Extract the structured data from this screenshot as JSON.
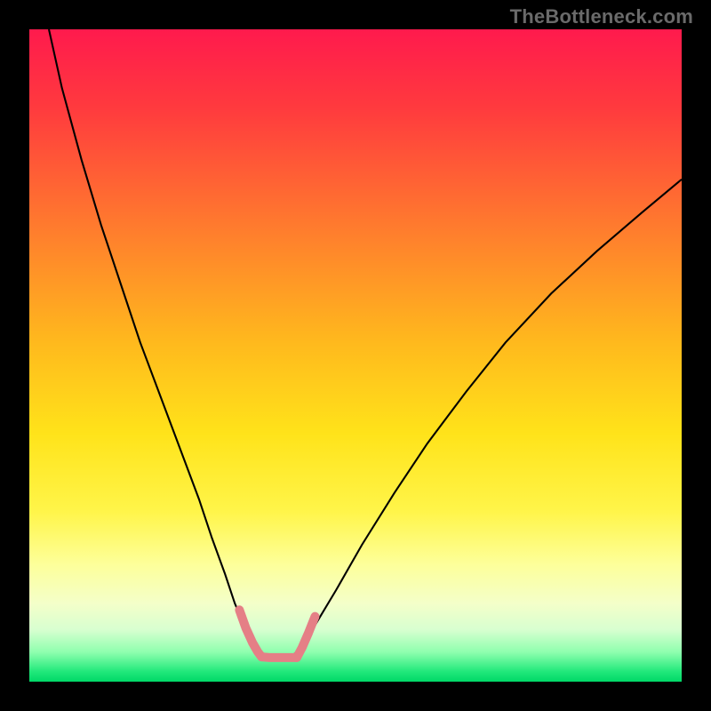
{
  "watermark": {
    "text": "TheBottleneck.com"
  },
  "chart_data": {
    "type": "line",
    "title": "",
    "xlabel": "",
    "ylabel": "",
    "xlim": [
      0,
      100
    ],
    "ylim": [
      0,
      100
    ],
    "grid": false,
    "legend": false,
    "gradient_stops": [
      {
        "pos": 0.0,
        "color": "#ff1a4d"
      },
      {
        "pos": 0.12,
        "color": "#ff3a3e"
      },
      {
        "pos": 0.3,
        "color": "#ff7a2e"
      },
      {
        "pos": 0.48,
        "color": "#ffb91d"
      },
      {
        "pos": 0.62,
        "color": "#ffe31a"
      },
      {
        "pos": 0.74,
        "color": "#fff54a"
      },
      {
        "pos": 0.82,
        "color": "#fdff9a"
      },
      {
        "pos": 0.88,
        "color": "#f4ffc9"
      },
      {
        "pos": 0.92,
        "color": "#d8ffd0"
      },
      {
        "pos": 0.955,
        "color": "#8effae"
      },
      {
        "pos": 0.985,
        "color": "#20e87a"
      },
      {
        "pos": 1.0,
        "color": "#00d867"
      }
    ],
    "series": [
      {
        "name": "left-branch",
        "stroke": "#000000",
        "stroke_width": 2.1,
        "x": [
          3,
          5,
          8,
          11,
          14,
          17,
          20,
          23,
          26,
          28,
          30,
          31.5,
          33,
          34,
          34.8,
          35.4
        ],
        "y": [
          100,
          91,
          80,
          70,
          61,
          52,
          44,
          36,
          28,
          22,
          16.5,
          12,
          8.5,
          6,
          4.4,
          3.7
        ]
      },
      {
        "name": "right-branch",
        "stroke": "#000000",
        "stroke_width": 2.1,
        "x": [
          40,
          41.5,
          44,
          47,
          51,
          56,
          61,
          67,
          73,
          80,
          87,
          94,
          100
        ],
        "y": [
          3.7,
          5,
          9,
          14,
          21,
          29,
          36.5,
          44.5,
          52,
          59.5,
          66,
          72,
          77
        ]
      },
      {
        "name": "handle-left",
        "stroke": "#e57f86",
        "stroke_width": 10,
        "linecap": "round",
        "x": [
          32.2,
          33.2,
          34.2,
          35.0,
          35.6
        ],
        "y": [
          11.0,
          8.2,
          6.0,
          4.6,
          3.8
        ]
      },
      {
        "name": "handle-bottom",
        "stroke": "#e57f86",
        "stroke_width": 10,
        "linecap": "round",
        "x": [
          35.6,
          36.8,
          38.2,
          39.6,
          41.0
        ],
        "y": [
          3.8,
          3.7,
          3.7,
          3.7,
          3.7
        ]
      },
      {
        "name": "handle-right",
        "stroke": "#e57f86",
        "stroke_width": 10,
        "linecap": "round",
        "x": [
          41.0,
          41.8,
          42.8,
          43.8
        ],
        "y": [
          3.7,
          5.2,
          7.5,
          10.0
        ]
      }
    ]
  }
}
